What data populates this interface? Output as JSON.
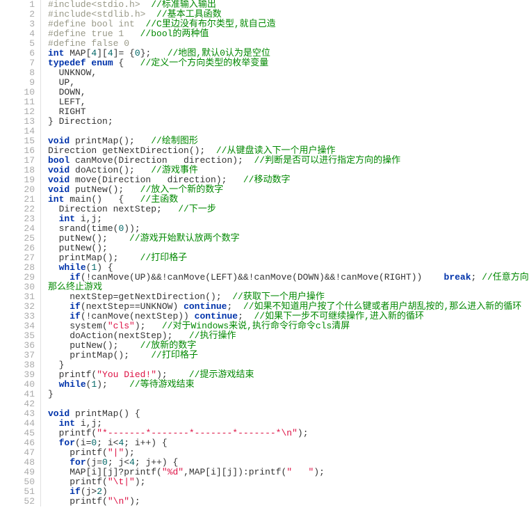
{
  "lines": [
    {
      "n": 1,
      "segs": [
        [
          "pp",
          "#include<stdio.h>  "
        ],
        [
          "cmt",
          "//标准输入输出"
        ]
      ]
    },
    {
      "n": 2,
      "segs": [
        [
          "pp",
          "#include<stdlib.h>  "
        ],
        [
          "cmt",
          "//基本工具函数"
        ]
      ]
    },
    {
      "n": 3,
      "segs": [
        [
          "pp",
          "#define bool int  "
        ],
        [
          "cmt",
          "//C里边没有布尔类型,就自己造"
        ]
      ]
    },
    {
      "n": 4,
      "segs": [
        [
          "pp",
          "#define true 1   "
        ],
        [
          "cmt",
          "//bool的两种值"
        ]
      ]
    },
    {
      "n": 5,
      "segs": [
        [
          "pp",
          "#define false 0"
        ]
      ]
    },
    {
      "n": 6,
      "segs": [
        [
          "kw",
          "int"
        ],
        [
          "",
          " MAP["
        ],
        [
          "num",
          "4"
        ],
        [
          "",
          "]["
        ],
        [
          "num",
          "4"
        ],
        [
          "",
          "]= {"
        ],
        [
          "num",
          "0"
        ],
        [
          "",
          "};   "
        ],
        [
          "cmt",
          "//地图,默认0认为是空位"
        ]
      ]
    },
    {
      "n": 7,
      "segs": [
        [
          "kw",
          "typedef enum"
        ],
        [
          "",
          " {   "
        ],
        [
          "cmt",
          "//定义一个方向类型的枚举变量"
        ]
      ]
    },
    {
      "n": 8,
      "segs": [
        [
          "",
          "  UNKNOW,"
        ]
      ]
    },
    {
      "n": 9,
      "segs": [
        [
          "",
          "  UP,"
        ]
      ]
    },
    {
      "n": 10,
      "segs": [
        [
          "",
          "  DOWN,"
        ]
      ]
    },
    {
      "n": 11,
      "segs": [
        [
          "",
          "  LEFT,"
        ]
      ]
    },
    {
      "n": 12,
      "segs": [
        [
          "",
          "  RIGHT"
        ]
      ]
    },
    {
      "n": 13,
      "segs": [
        [
          "",
          "} Direction;"
        ]
      ]
    },
    {
      "n": 14,
      "segs": [
        [
          "",
          ""
        ]
      ]
    },
    {
      "n": 15,
      "segs": [
        [
          "kw",
          "void"
        ],
        [
          "",
          " printMap();   "
        ],
        [
          "cmt",
          "//绘制图形"
        ]
      ]
    },
    {
      "n": 16,
      "segs": [
        [
          "",
          "Direction getNextDirection();  "
        ],
        [
          "cmt",
          "//从键盘读入下一个用户操作"
        ]
      ]
    },
    {
      "n": 17,
      "segs": [
        [
          "kw",
          "bool"
        ],
        [
          "",
          " canMove(Direction   direction);  "
        ],
        [
          "cmt",
          "//判断是否可以进行指定方向的操作"
        ]
      ]
    },
    {
      "n": 18,
      "segs": [
        [
          "kw",
          "void"
        ],
        [
          "",
          " doAction();   "
        ],
        [
          "cmt",
          "//游戏事件"
        ]
      ]
    },
    {
      "n": 19,
      "segs": [
        [
          "kw",
          "void"
        ],
        [
          "",
          " move(Direction   direction);   "
        ],
        [
          "cmt",
          "//移动数字"
        ]
      ]
    },
    {
      "n": 20,
      "segs": [
        [
          "kw",
          "void"
        ],
        [
          "",
          " putNew();   "
        ],
        [
          "cmt",
          "//放入一个新的数字"
        ]
      ]
    },
    {
      "n": 21,
      "segs": [
        [
          "kw",
          "int"
        ],
        [
          "",
          " main()   {   "
        ],
        [
          "cmt",
          "//主函数"
        ]
      ]
    },
    {
      "n": 22,
      "segs": [
        [
          "",
          "  Direction nextStep;   "
        ],
        [
          "cmt",
          "//下一步"
        ]
      ]
    },
    {
      "n": 23,
      "segs": [
        [
          "",
          "  "
        ],
        [
          "kw",
          "int"
        ],
        [
          "",
          " i,j;"
        ]
      ]
    },
    {
      "n": 24,
      "segs": [
        [
          "",
          "  "
        ],
        [
          "fn",
          "srand"
        ],
        [
          "",
          "("
        ],
        [
          "fn",
          "time"
        ],
        [
          "",
          "("
        ],
        [
          "num",
          "0"
        ],
        [
          "",
          "));"
        ]
      ]
    },
    {
      "n": 25,
      "segs": [
        [
          "",
          "  putNew();    "
        ],
        [
          "cmt",
          "//游戏开始默认放两个数字"
        ]
      ]
    },
    {
      "n": 26,
      "segs": [
        [
          "",
          "  putNew();"
        ]
      ]
    },
    {
      "n": 27,
      "segs": [
        [
          "",
          "  printMap();    "
        ],
        [
          "cmt",
          "//打印格子"
        ]
      ]
    },
    {
      "n": 28,
      "segs": [
        [
          "",
          "  "
        ],
        [
          "kw",
          "while"
        ],
        [
          "",
          "("
        ],
        [
          "num",
          "1"
        ],
        [
          "",
          ") {"
        ]
      ]
    },
    {
      "n": 29,
      "segs": [
        [
          "",
          "    "
        ],
        [
          "kw",
          "if"
        ],
        [
          "",
          "(!canMove(UP)&&!canMove(LEFT)&&!canMove(DOWN)&&!canMove(RIGHT))    "
        ],
        [
          "kw",
          "break"
        ],
        [
          "",
          "; "
        ],
        [
          "cmt",
          "//任意方向都不能移动,"
        ]
      ]
    },
    {
      "n": 30,
      "segs": [
        [
          "cmt",
          "那么终止游戏"
        ]
      ]
    },
    {
      "n": 31,
      "segs": [
        [
          "",
          "    nextStep=getNextDirection();  "
        ],
        [
          "cmt",
          "//获取下一个用户操作"
        ]
      ]
    },
    {
      "n": 32,
      "segs": [
        [
          "",
          "    "
        ],
        [
          "kw",
          "if"
        ],
        [
          "",
          "(nextStep==UNKNOW) "
        ],
        [
          "kw",
          "continue"
        ],
        [
          "",
          ";  "
        ],
        [
          "cmt",
          "//如果不知道用户按了个什么键或者用户胡乱按的,那么进入新的循环"
        ]
      ]
    },
    {
      "n": 33,
      "segs": [
        [
          "",
          "    "
        ],
        [
          "kw",
          "if"
        ],
        [
          "",
          "(!canMove(nextStep)) "
        ],
        [
          "kw",
          "continue"
        ],
        [
          "",
          ";  "
        ],
        [
          "cmt",
          "//如果下一步不可继续操作,进入新的循环"
        ]
      ]
    },
    {
      "n": 34,
      "segs": [
        [
          "",
          "    "
        ],
        [
          "fn",
          "system"
        ],
        [
          "",
          "("
        ],
        [
          "str",
          "\"cls\""
        ],
        [
          "",
          ");   "
        ],
        [
          "cmt",
          "//对于Windows来说,执行命令行命令cls清屏"
        ]
      ]
    },
    {
      "n": 35,
      "segs": [
        [
          "",
          "    doAction(nextStep);   "
        ],
        [
          "cmt",
          "//执行操作"
        ]
      ]
    },
    {
      "n": 36,
      "segs": [
        [
          "",
          "    putNew();    "
        ],
        [
          "cmt",
          "//放新的数字"
        ]
      ]
    },
    {
      "n": 37,
      "segs": [
        [
          "",
          "    printMap();    "
        ],
        [
          "cmt",
          "//打印格子"
        ]
      ]
    },
    {
      "n": 38,
      "segs": [
        [
          "",
          "  }"
        ]
      ]
    },
    {
      "n": 39,
      "segs": [
        [
          "",
          "  "
        ],
        [
          "fn",
          "printf"
        ],
        [
          "",
          "("
        ],
        [
          "str",
          "\"You Died!\""
        ],
        [
          "",
          ");    "
        ],
        [
          "cmt",
          "//提示游戏结束"
        ]
      ]
    },
    {
      "n": 40,
      "segs": [
        [
          "",
          "  "
        ],
        [
          "kw",
          "while"
        ],
        [
          "",
          "("
        ],
        [
          "num",
          "1"
        ],
        [
          "",
          ");    "
        ],
        [
          "cmt",
          "//等待游戏结束"
        ]
      ]
    },
    {
      "n": 41,
      "segs": [
        [
          "",
          "}"
        ]
      ]
    },
    {
      "n": 42,
      "segs": [
        [
          "",
          ""
        ]
      ]
    },
    {
      "n": 43,
      "segs": [
        [
          "kw",
          "void"
        ],
        [
          "",
          " printMap() {"
        ]
      ]
    },
    {
      "n": 44,
      "segs": [
        [
          "",
          "  "
        ],
        [
          "kw",
          "int"
        ],
        [
          "",
          " i,j;"
        ]
      ]
    },
    {
      "n": 45,
      "segs": [
        [
          "",
          "  "
        ],
        [
          "fn",
          "printf"
        ],
        [
          "",
          "("
        ],
        [
          "str",
          "\"*-------*-------*-------*-------*\\n\""
        ],
        [
          "",
          ");"
        ]
      ]
    },
    {
      "n": 46,
      "segs": [
        [
          "",
          "  "
        ],
        [
          "kw",
          "for"
        ],
        [
          "",
          "(i="
        ],
        [
          "num",
          "0"
        ],
        [
          "",
          "; i<"
        ],
        [
          "num",
          "4"
        ],
        [
          "",
          "; i++) {"
        ]
      ]
    },
    {
      "n": 47,
      "segs": [
        [
          "",
          "    "
        ],
        [
          "fn",
          "printf"
        ],
        [
          "",
          "("
        ],
        [
          "str",
          "\"|\""
        ],
        [
          "",
          ");"
        ]
      ]
    },
    {
      "n": 48,
      "segs": [
        [
          "",
          "    "
        ],
        [
          "kw",
          "for"
        ],
        [
          "",
          "(j="
        ],
        [
          "num",
          "0"
        ],
        [
          "",
          "; j<"
        ],
        [
          "num",
          "4"
        ],
        [
          "",
          "; j++) {"
        ]
      ]
    },
    {
      "n": 49,
      "segs": [
        [
          "",
          "    MAP[i][j]?"
        ],
        [
          "fn",
          "printf"
        ],
        [
          "",
          "("
        ],
        [
          "str",
          "\"%d\""
        ],
        [
          "",
          ",MAP[i][j]):"
        ],
        [
          "fn",
          "printf"
        ],
        [
          "",
          "("
        ],
        [
          "str",
          "\"   \""
        ],
        [
          "",
          ");"
        ]
      ]
    },
    {
      "n": 50,
      "segs": [
        [
          "",
          "    "
        ],
        [
          "fn",
          "printf"
        ],
        [
          "",
          "("
        ],
        [
          "str",
          "\"\\t|\""
        ],
        [
          "",
          ");"
        ]
      ]
    },
    {
      "n": 51,
      "segs": [
        [
          "",
          "    "
        ],
        [
          "kw",
          "if"
        ],
        [
          "",
          "(j>"
        ],
        [
          "num",
          "2"
        ],
        [
          "",
          ")"
        ]
      ]
    },
    {
      "n": 52,
      "segs": [
        [
          "",
          "    "
        ],
        [
          "fn",
          "printf"
        ],
        [
          "",
          "("
        ],
        [
          "str",
          "\"\\n\""
        ],
        [
          "",
          ");"
        ]
      ]
    }
  ]
}
